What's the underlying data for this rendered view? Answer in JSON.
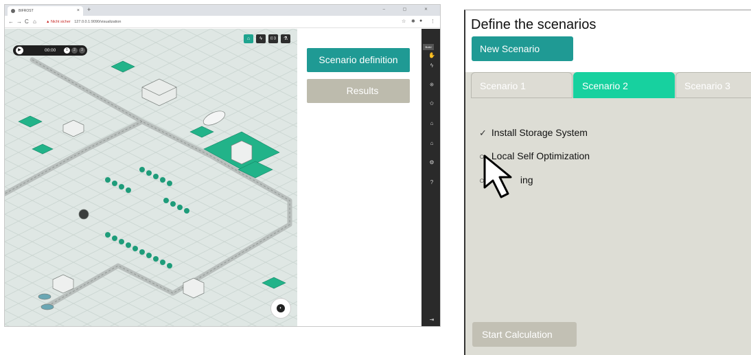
{
  "browser": {
    "tab_title": "BIFROST",
    "tab_close": "×",
    "new_tab": "+",
    "window_controls": "–  ▢  ✕",
    "nav": {
      "back": "←",
      "forward": "→",
      "reload": "C",
      "home": "⌂"
    },
    "url_warning_icon": "▲",
    "url_warning": "Nicht sicher",
    "url": "127.0.0.1:9090/visualization"
  },
  "map": {
    "clock": "00:00",
    "speed_buttons": [
      "1",
      "2",
      "3"
    ],
    "tools": [
      "⌂",
      "ϟ",
      "((·))",
      "⚗"
    ],
    "compass_icon": "◐"
  },
  "side_panel": {
    "scenario_definition": "Scenario definition",
    "results": "Results"
  },
  "toolbar": {
    "build": "Build",
    "icons": [
      "✋",
      "ϟ",
      "⁜",
      "✩",
      "⌂",
      "⌂",
      "⚙",
      "?"
    ],
    "logout_icon": "⇥"
  },
  "zoom": {
    "title": "Define the scenarios",
    "new_scenario": "New Scenario",
    "tabs": [
      {
        "label": "Scenario 1",
        "active": false
      },
      {
        "label": "Scenario 2",
        "active": true
      },
      {
        "label": "Scenario 3",
        "active": false
      }
    ],
    "options": [
      {
        "mark": "✓",
        "label": "Install Storage System"
      },
      {
        "mark": "○",
        "label": "Local Self Optimization"
      },
      {
        "mark": "○",
        "label": "ing"
      }
    ],
    "start_calculation": "Start Calculation"
  },
  "colors": {
    "teal": "#1f9a94",
    "scenario_active": "#17d19f",
    "results_gray": "#bdbbad",
    "panel_bg": "#ddddd5",
    "map_bg": "#dfe7e4"
  }
}
